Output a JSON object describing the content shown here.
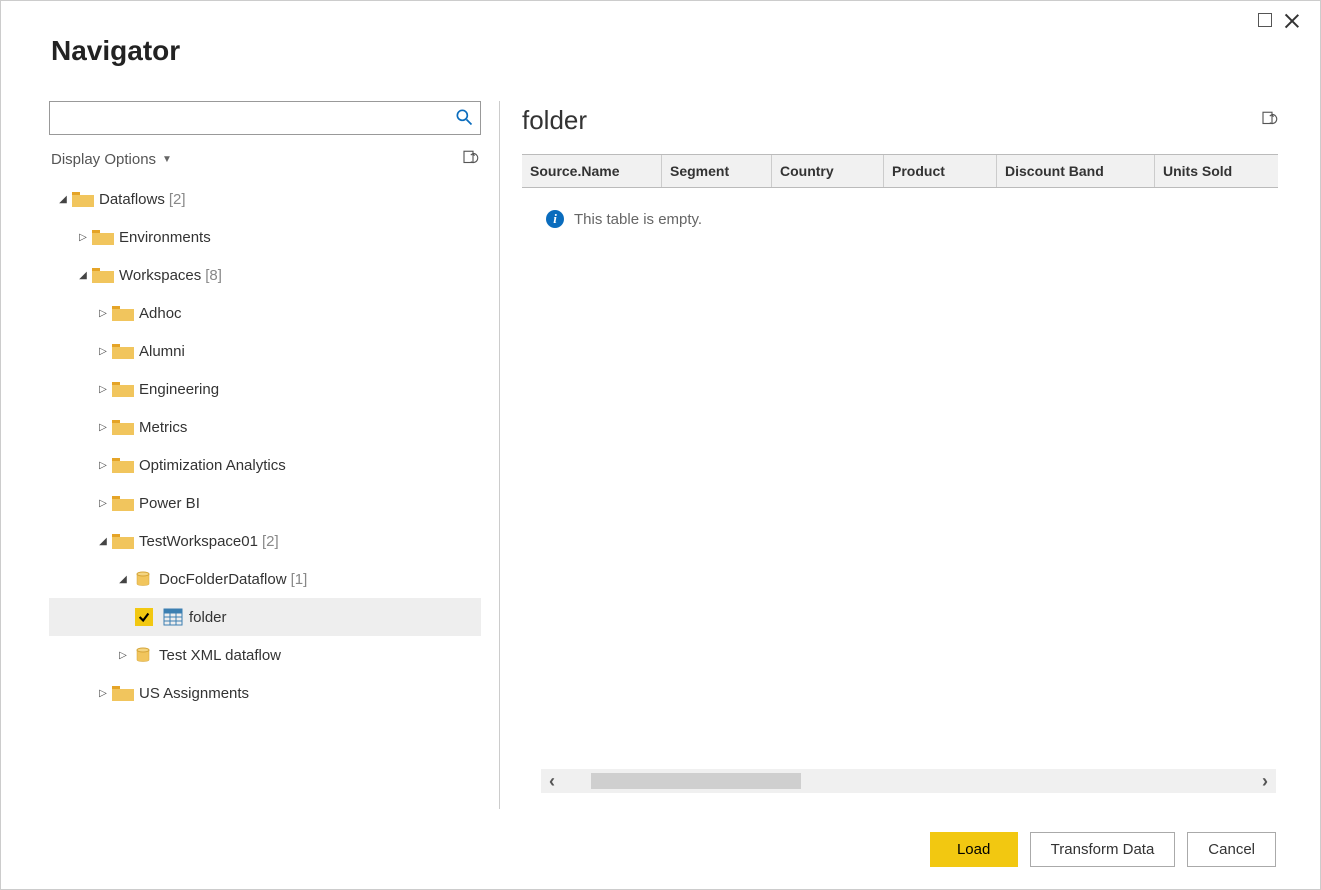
{
  "title": "Navigator",
  "search": {
    "placeholder": ""
  },
  "options": {
    "label": "Display Options"
  },
  "tree": {
    "root": {
      "label": "Dataflows",
      "count": "[2]"
    },
    "env": {
      "label": "Environments"
    },
    "workspaces": {
      "label": "Workspaces",
      "count": "[8]"
    },
    "adhoc": {
      "label": "Adhoc"
    },
    "alumni": {
      "label": "Alumni"
    },
    "eng": {
      "label": "Engineering"
    },
    "metrics": {
      "label": "Metrics"
    },
    "optim": {
      "label": "Optimization Analytics"
    },
    "pbi": {
      "label": "Power BI"
    },
    "test": {
      "label": "TestWorkspace01",
      "count": "[2]"
    },
    "docflow": {
      "label": "DocFolderDataflow",
      "count": "[1]"
    },
    "folder": {
      "label": "folder"
    },
    "xml": {
      "label": "Test XML dataflow"
    },
    "usasg": {
      "label": "US Assignments"
    }
  },
  "preview": {
    "title": "folder",
    "columns": [
      "Source.Name",
      "Segment",
      "Country",
      "Product",
      "Discount Band",
      "Units Sold"
    ],
    "empty_msg": "This table is empty."
  },
  "buttons": {
    "load": "Load",
    "transform": "Transform Data",
    "cancel": "Cancel"
  }
}
